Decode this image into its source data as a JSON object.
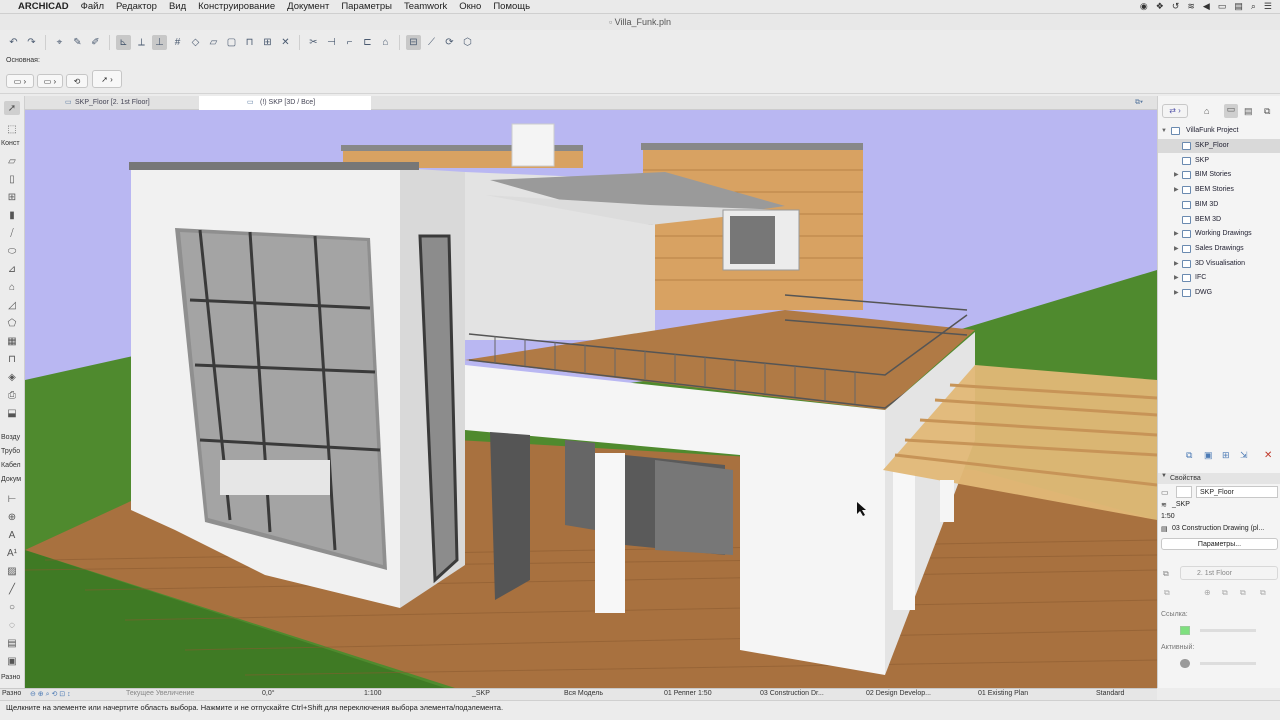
{
  "menubar": {
    "apple": "",
    "app_name": "ARCHICAD",
    "items": [
      "Файл",
      "Редактор",
      "Вид",
      "Конструирование",
      "Документ",
      "Параметры",
      "Teamwork",
      "Окно",
      "Помощь"
    ]
  },
  "window": {
    "title": "Villa_Funk.pln"
  },
  "infobox": {
    "label": "Основная:"
  },
  "toolbox": {
    "labels": [
      "Конст",
      "Возду",
      "Трубо",
      "Кабел",
      "Докум",
      "Разно"
    ]
  },
  "tabs": [
    {
      "label": "SKP_Floor [2. 1st Floor]",
      "active": false
    },
    {
      "label": "(!) SKP [3D / Все]",
      "active": true
    }
  ],
  "navigator": {
    "project": "VillaFunk Project",
    "items": [
      {
        "label": "SKP_Floor",
        "selected": true,
        "level": 1,
        "expandable": false
      },
      {
        "label": "SKP",
        "selected": false,
        "level": 1,
        "expandable": false
      },
      {
        "label": "BIM Stories",
        "selected": false,
        "level": 1,
        "expandable": true
      },
      {
        "label": "BEM Stories",
        "selected": false,
        "level": 1,
        "expandable": true
      },
      {
        "label": "BIM 3D",
        "selected": false,
        "level": 1,
        "expandable": false
      },
      {
        "label": "BEM 3D",
        "selected": false,
        "level": 1,
        "expandable": false
      },
      {
        "label": "Working Drawings",
        "selected": false,
        "level": 1,
        "expandable": true
      },
      {
        "label": "Sales Drawings",
        "selected": false,
        "level": 1,
        "expandable": true
      },
      {
        "label": "3D Visualisation",
        "selected": false,
        "level": 1,
        "expandable": true
      },
      {
        "label": "IFC",
        "selected": false,
        "level": 1,
        "expandable": true
      },
      {
        "label": "DWG",
        "selected": false,
        "level": 1,
        "expandable": true
      }
    ]
  },
  "properties": {
    "header": "Свойства",
    "name": "SKP_Floor",
    "id": "_SKP",
    "scale": "1:50",
    "drawing": "03 Construction Drawing (pl...",
    "button": "Параметры...",
    "story": "2. 1st Floor",
    "links_label": "Ссылка:",
    "active_label": "Активный:"
  },
  "statusbar": {
    "zoom_placeholder": "Текущее Увеличение",
    "angle": "0,0°",
    "scale": "1:100",
    "layer": "_SKP",
    "model": "Вся Модель",
    "pen": "01 Реппег 1:50",
    "mvo": "03 Construction Dr...",
    "design": "02 Design Develop...",
    "renovation": "01 Existing Plan",
    "style": "Standard"
  },
  "hint": "Щелкните на элементе или начертите область выбора. Нажмите и не отпускайте Ctrl+Shift для переключения выбора элемента/подэлемента.",
  "colors": {
    "sky": "#b9b7f2",
    "grass": "#4f8a2e",
    "deck": "#a8713f",
    "wall": "#f2f2f2",
    "wood_cladding": "#d8a262",
    "accent_selected": "#d9d9d9"
  }
}
